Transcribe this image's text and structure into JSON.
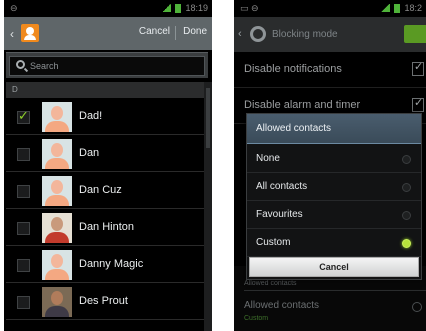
{
  "left": {
    "statusbar": {
      "left_icon": "⊖",
      "right_text": "18:19"
    },
    "header": {
      "cancel_label": "Cancel",
      "done_label": "Done"
    },
    "search": {
      "placeholder": "Search"
    },
    "section_letter": "D",
    "contacts": [
      {
        "name": "Dad!",
        "checked": true
      },
      {
        "name": "Dan",
        "checked": false
      },
      {
        "name": "Dan Cuz",
        "checked": false
      },
      {
        "name": "Dan Hinton",
        "checked": false
      },
      {
        "name": "Danny Magic",
        "checked": false
      },
      {
        "name": "Des Prout",
        "checked": false
      }
    ]
  },
  "right": {
    "statusbar": {
      "left_icon": "▭ ⊖",
      "right_text": "18:2"
    },
    "header": {
      "title": "Blocking mode"
    },
    "settings": {
      "disable_notifications": "Disable notifications",
      "disable_alarm": "Disable alarm and timer"
    },
    "dialog": {
      "title": "Allowed contacts",
      "options": [
        {
          "label": "None",
          "selected": false
        },
        {
          "label": "All contacts",
          "selected": false
        },
        {
          "label": "Favourites",
          "selected": false
        },
        {
          "label": "Custom",
          "selected": true
        }
      ],
      "cancel_label": "Cancel"
    },
    "underneath": {
      "section": "Allowed contacts",
      "label": "Allowed contacts",
      "sub": "Custom"
    }
  },
  "colors": {
    "accent_green": "#b7e23c",
    "header_grey": "#5f6669",
    "dialog_title_blue": "#4a5d6e"
  }
}
